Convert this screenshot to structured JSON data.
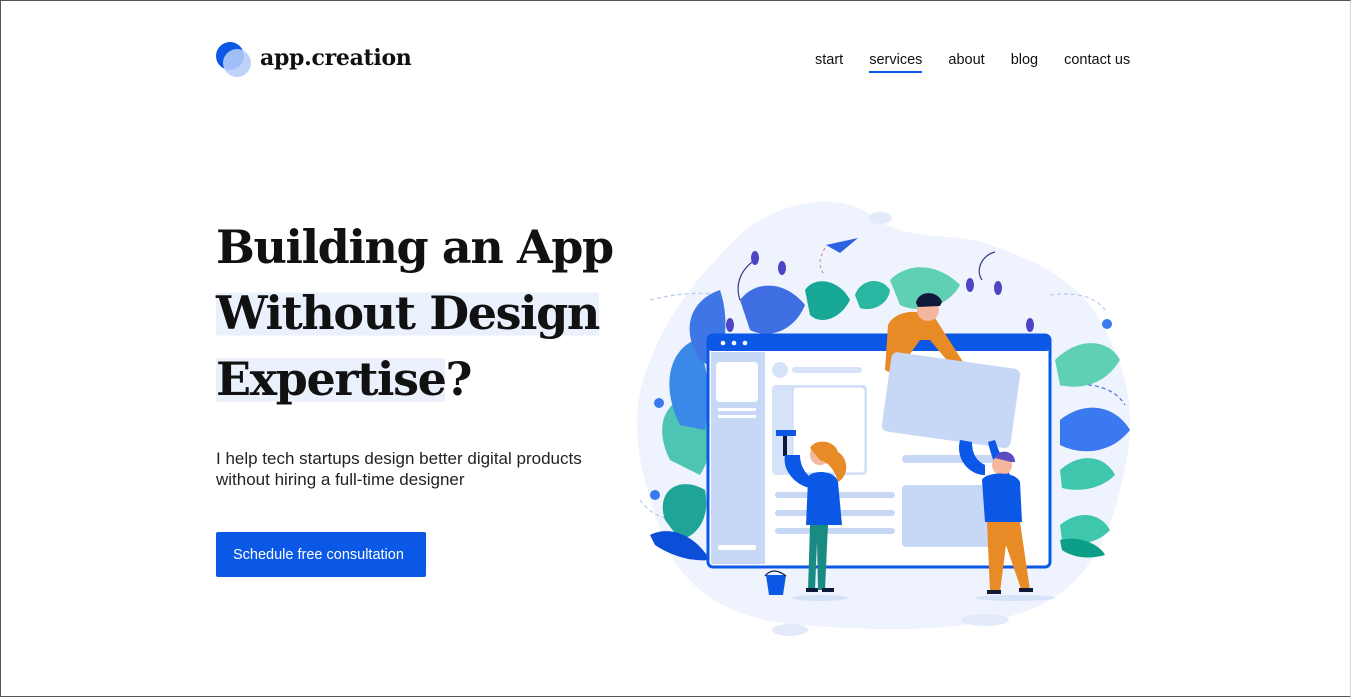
{
  "brand": {
    "name": "app.creation",
    "logo_icon": "overlapping-circles-logo",
    "accent_color": "#0b58e6"
  },
  "nav": {
    "items": [
      {
        "label": "start",
        "active": false
      },
      {
        "label": "services",
        "active": true
      },
      {
        "label": "about",
        "active": false
      },
      {
        "label": "blog",
        "active": false
      },
      {
        "label": "contact us",
        "active": false
      }
    ]
  },
  "hero": {
    "title_lines": [
      "Building an App",
      "Without Design",
      "Expertise"
    ],
    "title_punct": "?",
    "description": "I help tech startups design better digital products without hiring a full-time designer",
    "cta_label": "Schedule free consultation"
  },
  "illustration": {
    "icon": "web-design-team-illustration"
  }
}
